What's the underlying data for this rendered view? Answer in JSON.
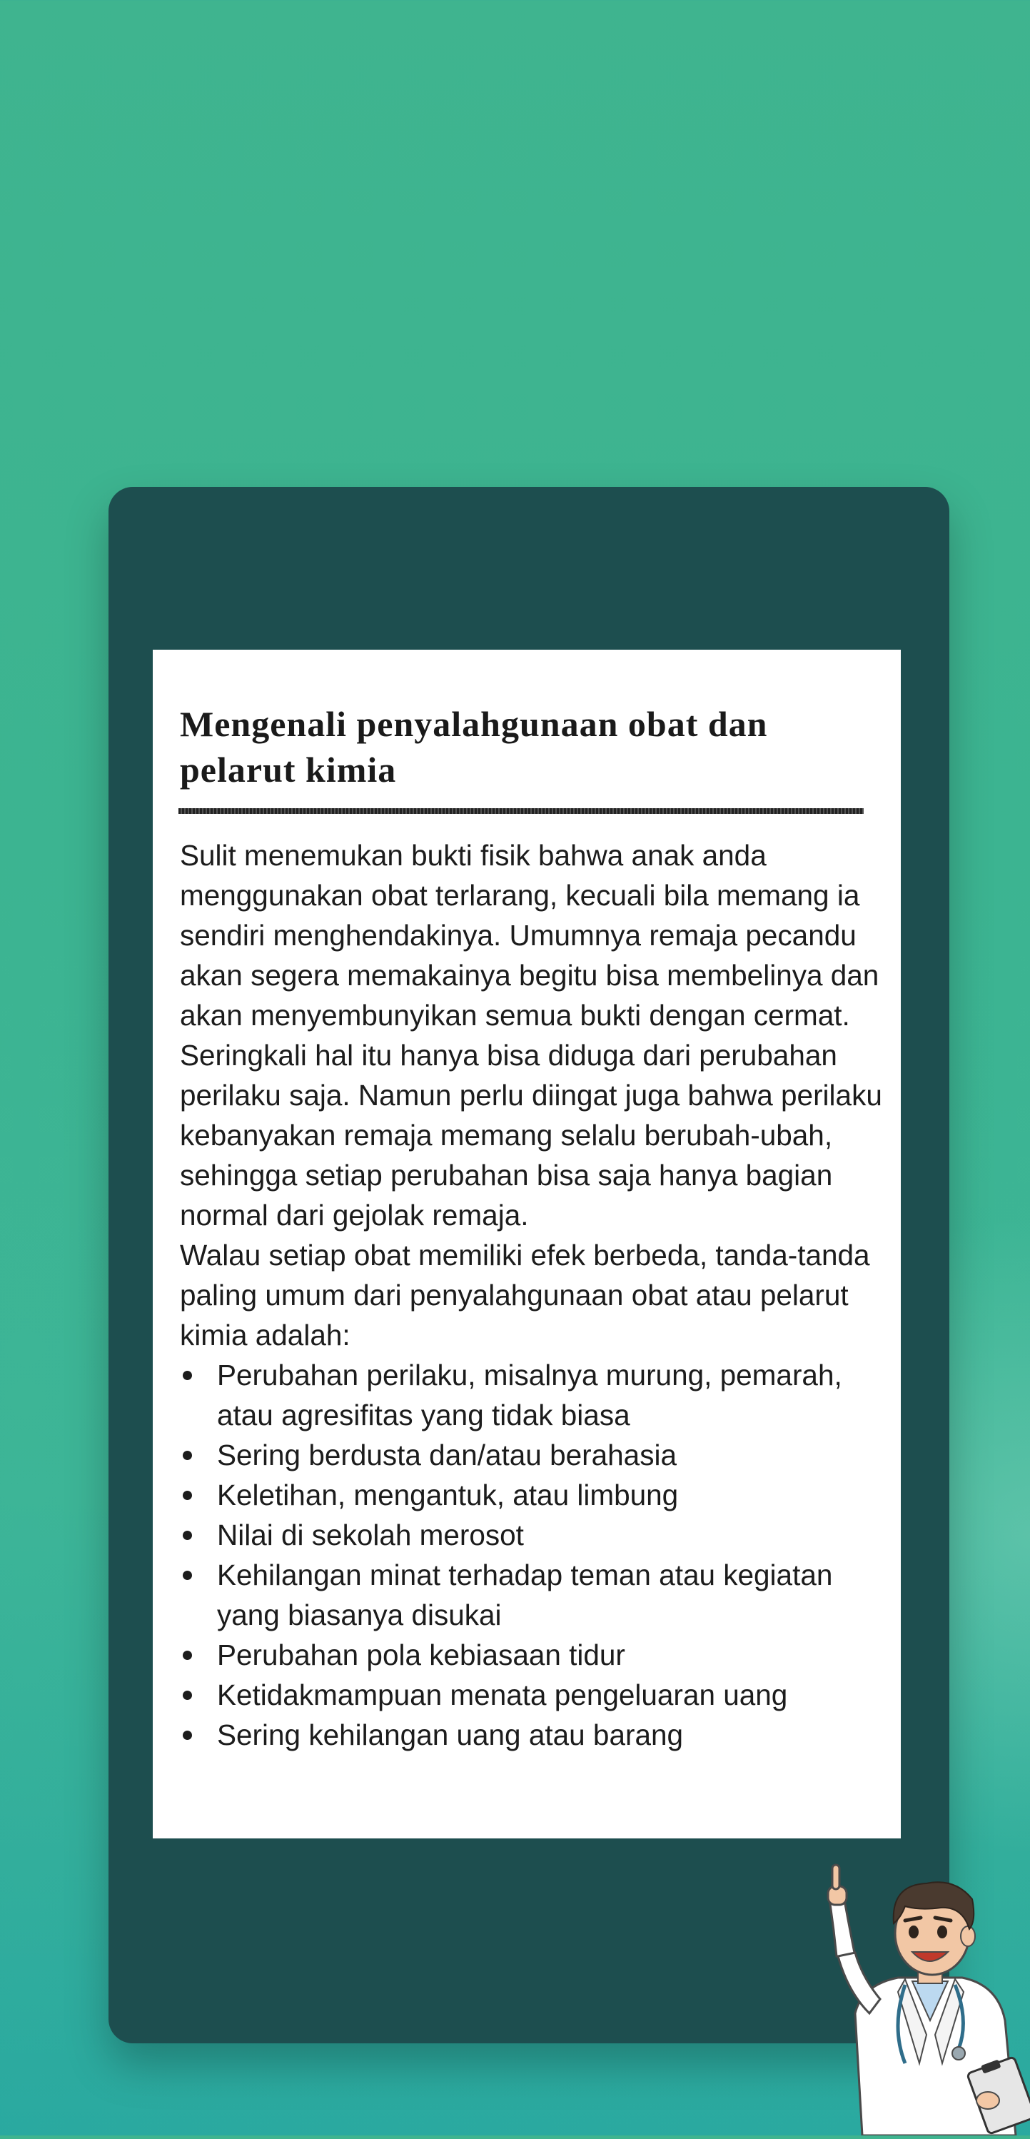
{
  "colors": {
    "background_top": "#3fb48f",
    "background_bottom": "#2aa9a0",
    "card": "#1d4e4f",
    "paper": "#ffffff",
    "text": "#1c1c1c"
  },
  "document": {
    "title": "Mengenali penyalahgunaan obat dan pelarut kimia",
    "paragraph_1": "Sulit menemukan bukti fisik bahwa anak anda menggunakan obat terlarang, kecuali bila memang ia sendiri menghendakinya. Umumnya remaja pecandu akan segera memakainya begitu bisa membelinya dan akan menyembunyikan semua bukti dengan cermat. Seringkali hal itu hanya bisa diduga dari perubahan perilaku saja. Namun perlu diingat juga bahwa perilaku kebanyakan remaja memang selalu berubah-ubah, sehingga setiap perubahan bisa saja hanya bagian normal dari gejolak remaja.",
    "paragraph_2": "Walau setiap obat memiliki efek berbeda, tanda-tanda paling umum dari penyalahgunaan obat atau pelarut kimia adalah:",
    "signs": [
      "Perubahan perilaku, misalnya murung, pemarah, atau agresifitas yang tidak biasa",
      "Sering berdusta dan/atau berahasia",
      "Keletihan, mengantuk, atau limbung",
      "Nilai di sekolah merosot",
      "Kehilangan minat terhadap teman atau kegiatan yang biasanya disukai",
      "Perubahan pola kebiasaan tidur",
      "Ketidakmampuan menata pengeluaran uang",
      "Sering kehilangan uang atau barang"
    ]
  },
  "illustration": {
    "icon": "doctor-pointing-icon"
  }
}
